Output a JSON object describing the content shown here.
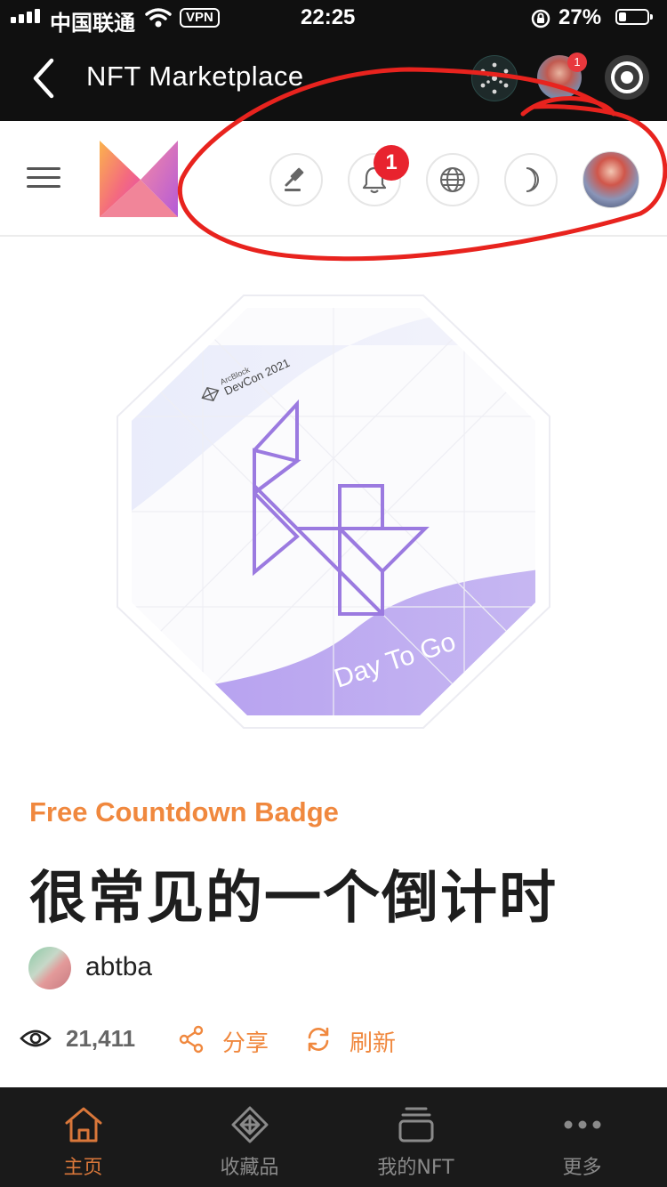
{
  "status_bar": {
    "carrier": "中国联通",
    "vpn_label": "VPN",
    "time": "22:25",
    "battery_percent": "27%",
    "battery_level": 0.27
  },
  "app_bar": {
    "title": "NFT Marketplace",
    "avatar_badge": "1"
  },
  "header": {
    "icons": [
      "menu-icon",
      "logo",
      "auction-gavel-icon",
      "bell-icon",
      "globe-icon",
      "moon-icon",
      "avatar"
    ],
    "notification_count": "1"
  },
  "badge_image": {
    "brand_small": "ArcBlock",
    "event": "DevCon 2021",
    "ribbon_text": "Day To Go",
    "accent_color": "#9b7ae0"
  },
  "nft": {
    "collection": "Free Countdown Badge",
    "title": "很常见的一个倒计时",
    "owner": "abtba",
    "views": "21,411",
    "share_label": "分享",
    "refresh_label": "刷新"
  },
  "tabs": [
    {
      "label": "主页",
      "icon": "home-icon",
      "active": true
    },
    {
      "label": "收藏品",
      "icon": "collection-icon",
      "active": false
    },
    {
      "label": "我的NFT",
      "icon": "stack-icon",
      "active": false
    },
    {
      "label": "更多",
      "icon": "more-icon",
      "active": false
    }
  ],
  "colors": {
    "accent": "#f0883e",
    "badge_red": "#e8232e",
    "tab_active": "#d9773a",
    "annotation_red": "#e8231e"
  }
}
